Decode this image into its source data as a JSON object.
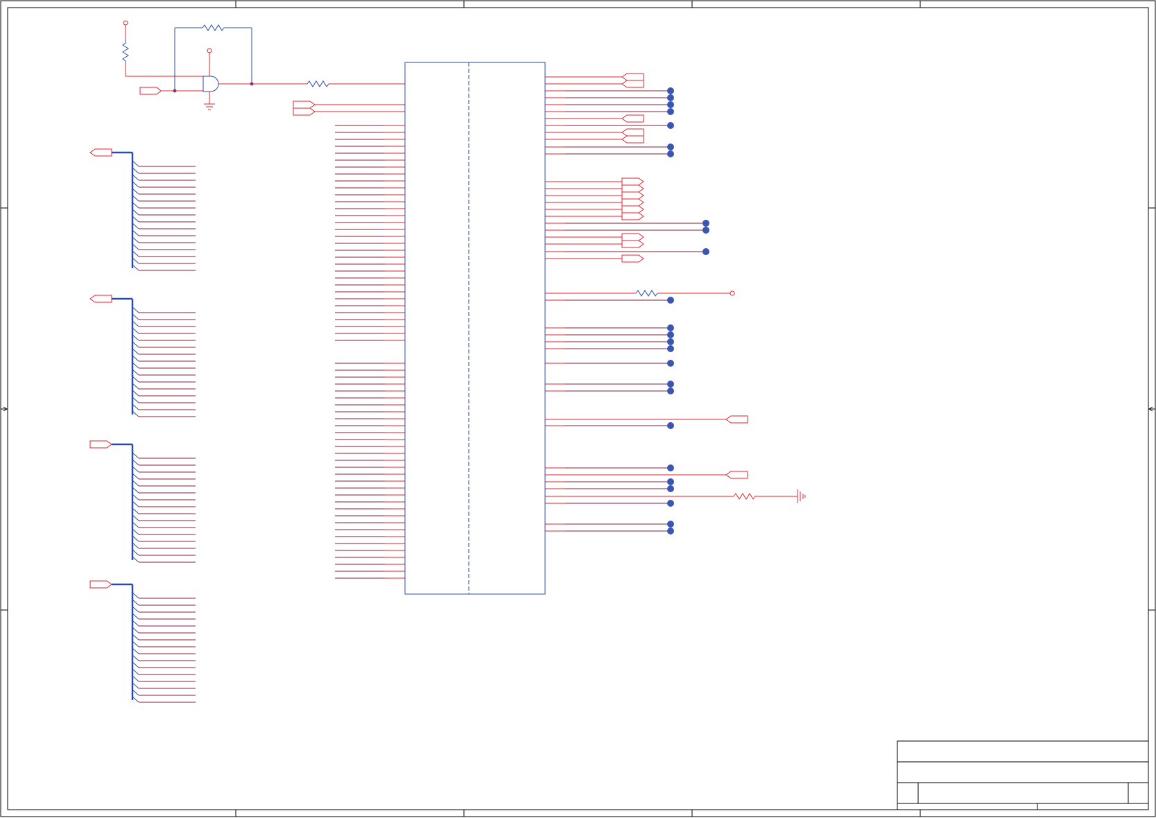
{
  "colors": {
    "wire": "#e3232b",
    "component": "#2b4ba8",
    "bus": "#2b4ba8",
    "frame": "#000000",
    "junction": "#3a56b0",
    "background": "#ffffff"
  },
  "labels": {
    "visible_text": []
  }
}
